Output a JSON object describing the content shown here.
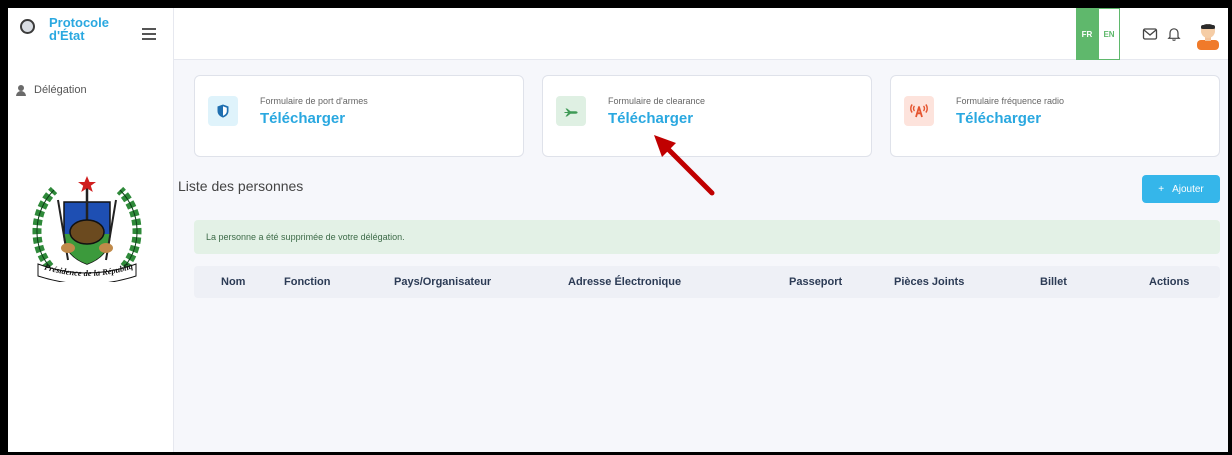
{
  "app": {
    "title": "Protocole d'État",
    "title_line1": "Protocole",
    "title_line2": "d'État"
  },
  "sidebar": {
    "items": [
      {
        "label": "Délégation",
        "icon": "user-icon"
      }
    ],
    "seal_text": "Présidence de la République"
  },
  "topbar": {
    "lang_fr": "FR",
    "lang_en": "EN",
    "active_lang": "FR",
    "icons": [
      "mail-icon",
      "bell-icon",
      "avatar"
    ]
  },
  "cards": [
    {
      "label": "Formulaire de port d'armes",
      "link": "Télécharger",
      "icon": "shield-icon",
      "icon_bg": "#dff3fb",
      "icon_color": "#1f86c7"
    },
    {
      "label": "Formulaire de clearance",
      "link": "Télécharger",
      "icon": "plane-icon",
      "icon_bg": "#dff0e3",
      "icon_color": "#3f9a56"
    },
    {
      "label": "Formulaire fréquence radio",
      "link": "Télécharger",
      "icon": "radio-tower-icon",
      "icon_bg": "#fde3dc",
      "icon_color": "#e5552f"
    }
  ],
  "list": {
    "title": "Liste des personnes",
    "add_label": "Ajouter",
    "add_icon": "plus-icon"
  },
  "alert": {
    "message": "La personne a été supprimée de votre délégation."
  },
  "table": {
    "columns": [
      "Nom",
      "Fonction",
      "Pays/Organisateur",
      "Adresse Électronique",
      "Passeport",
      "Pièces Joints",
      "Billet",
      "Actions"
    ]
  },
  "colors": {
    "accent": "#2aa8e0",
    "success": "#5fb86c",
    "annotation_arrow": "#c00000"
  }
}
